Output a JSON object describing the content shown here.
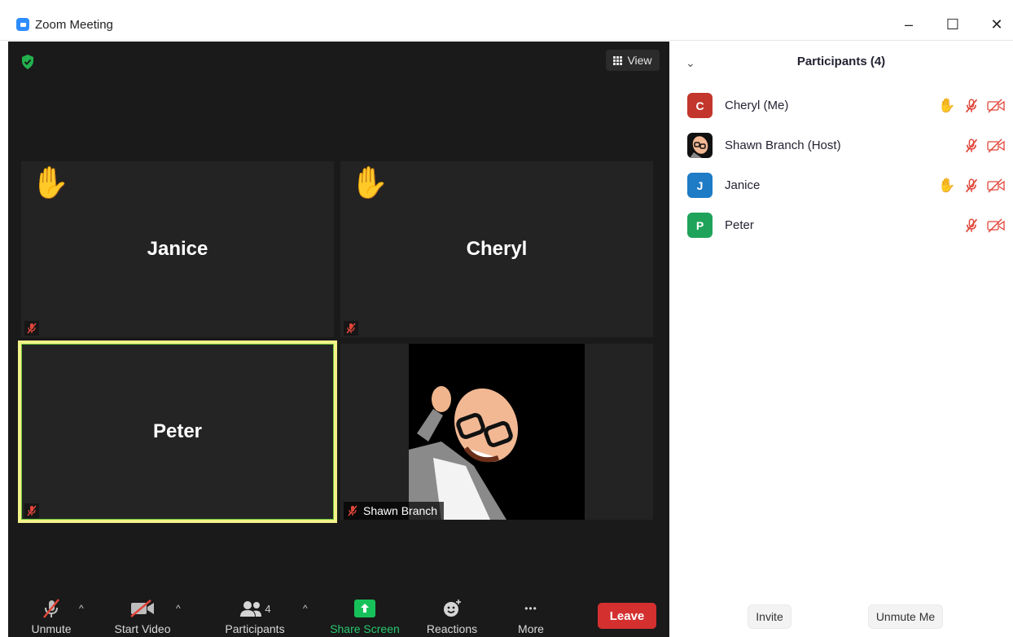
{
  "window": {
    "title": "Zoom Meeting",
    "min_glyph": "–",
    "max_glyph": "☐",
    "close_glyph": "✕"
  },
  "meeting": {
    "view_label": "View",
    "tiles": [
      {
        "name": "Janice",
        "hand_raised": true,
        "muted": true
      },
      {
        "name": "Cheryl",
        "hand_raised": true,
        "muted": true
      },
      {
        "name": "Peter",
        "hand_raised": false,
        "muted": true,
        "active_speaker": true
      },
      {
        "name": "Shawn Branch",
        "hand_raised": false,
        "muted": true,
        "video_on": true
      }
    ],
    "hand_glyph": "✋"
  },
  "toolbar": {
    "unmute": "Unmute",
    "start_video": "Start Video",
    "participants": "Participants",
    "participants_count": "4",
    "share_screen": "Share Screen",
    "reactions": "Reactions",
    "more": "More",
    "more_glyph": "•••",
    "leave": "Leave",
    "caret_glyph": "^"
  },
  "panel": {
    "title": "Participants (4)",
    "collapse_glyph": "⌄",
    "participants": [
      {
        "initial": "C",
        "name": "Cheryl (Me)",
        "color": "#c2362b",
        "hand_raised": true
      },
      {
        "initial": "",
        "name": "Shawn Branch (Host)",
        "color": "#111111",
        "hand_raised": false
      },
      {
        "initial": "J",
        "name": "Janice",
        "color": "#1e7bc6",
        "hand_raised": true
      },
      {
        "initial": "P",
        "name": "Peter",
        "color": "#1fa35a",
        "hand_raised": false
      }
    ],
    "invite": "Invite",
    "unmute_me": "Unmute Me"
  },
  "colors": {
    "meeting_bg": "#1a1a1a",
    "tile_bg": "#232323",
    "active_border": "#f3f38a",
    "leave": "#d3302f",
    "share": "#17c15a",
    "muted_red": "#e0463a",
    "hand": "#f5b400"
  }
}
